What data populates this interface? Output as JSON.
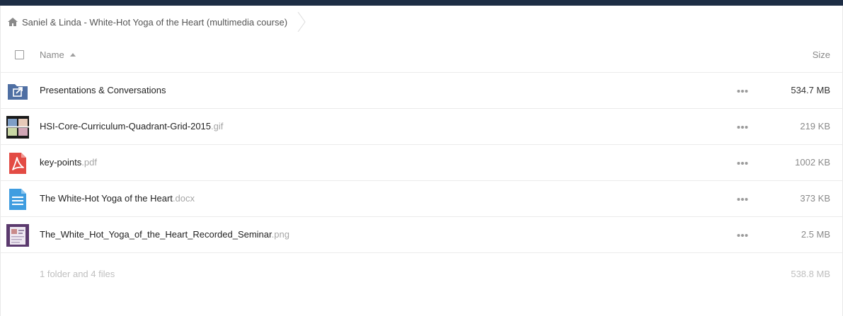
{
  "breadcrumb": {
    "home_icon": "home-icon",
    "current": "Saniel & Linda - White-Hot Yoga of the Heart (multimedia course)"
  },
  "table": {
    "header": {
      "name": "Name",
      "size": "Size",
      "sort": "ascending"
    },
    "rows": [
      {
        "icon": "shared-folder-icon",
        "name": "Presentations & Conversations",
        "ext": "",
        "size": "534.7 MB",
        "size_color": "#333333"
      },
      {
        "icon": "gif-thumbnail",
        "name": "HSI-Core-Curriculum-Quadrant-Grid-2015",
        "ext": ".gif",
        "size": "219 KB",
        "size_color": "#8a8a8a"
      },
      {
        "icon": "pdf-icon",
        "name": "key-points",
        "ext": ".pdf",
        "size": "1002 KB",
        "size_color": "#8a8a8a"
      },
      {
        "icon": "document-icon",
        "name": "The White-Hot Yoga of the Heart",
        "ext": ".docx",
        "size": "373 KB",
        "size_color": "#8a8a8a"
      },
      {
        "icon": "png-thumbnail",
        "name": "The_White_Hot_Yoga_of_the_Heart_Recorded_Seminar",
        "ext": ".png",
        "size": "2.5 MB",
        "size_color": "#8a8a8a"
      }
    ]
  },
  "summary": {
    "count": "1 folder and 4 files",
    "total": "538.8 MB"
  },
  "colors": {
    "topbar": "#1d2d44",
    "folder": "#4f6fa3",
    "pdf": "#e34b44",
    "doc": "#3f9de0"
  }
}
